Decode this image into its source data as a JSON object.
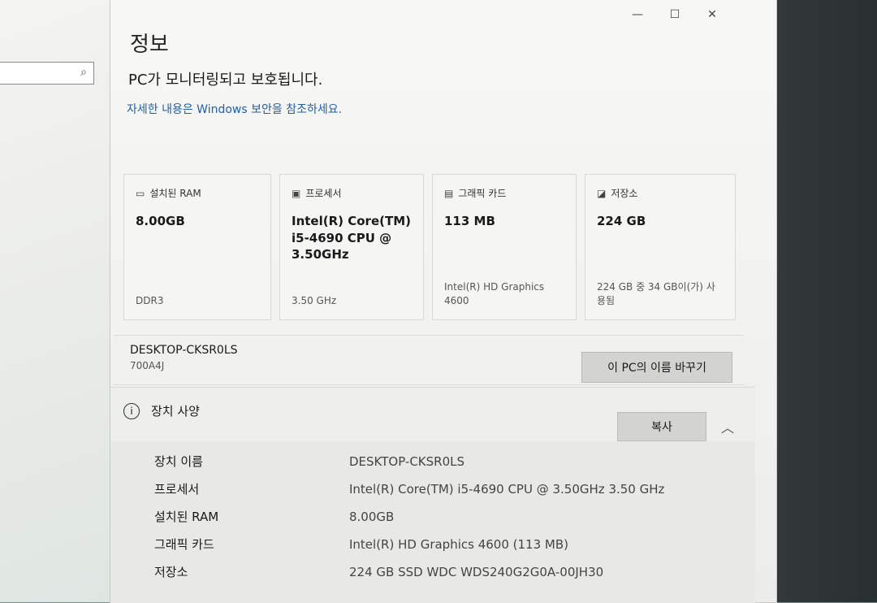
{
  "left_pane": {
    "search_icon": "search-icon"
  },
  "window": {
    "controls": {
      "minimize": "—",
      "maximize": "☐",
      "close": "✕"
    },
    "title": "정보",
    "status": "PC가 모니터링되고 보호됩니다.",
    "security_link": "자세한 내용은 Windows 보안을 참조하세요."
  },
  "cards": [
    {
      "icon": "ram-icon",
      "label": "설치된 RAM",
      "value": "8.00GB",
      "footnote": "DDR3"
    },
    {
      "icon": "processor-icon",
      "label": "프로세서",
      "value": "Intel(R) Core(TM) i5-4690 CPU @ 3.50GHz",
      "footnote": "3.50 GHz"
    },
    {
      "icon": "graphics-card-icon",
      "label": "그래픽 카드",
      "value": "113 MB",
      "footnote": "Intel(R) HD Graphics 4600"
    },
    {
      "icon": "storage-icon",
      "label": "저장소",
      "value": "224 GB",
      "footnote": "224 GB 중 34 GB이(가) 사용됨"
    }
  ],
  "device": {
    "name": "DESKTOP-CKSR0LS",
    "model": "700A4J",
    "rename_button": "이 PC의 이름 바꾸기"
  },
  "specs": {
    "title": "장치 사양",
    "copy_button": "복사",
    "rows": [
      {
        "label": "장치 이름",
        "value": "DESKTOP-CKSR0LS"
      },
      {
        "label": "프로세서",
        "value": "Intel(R) Core(TM) i5-4690 CPU @ 3.50GHz   3.50 GHz"
      },
      {
        "label": "설치된 RAM",
        "value": "8.00GB"
      },
      {
        "label": "그래픽 카드",
        "value": "Intel(R) HD Graphics 4600 (113 MB)"
      },
      {
        "label": "저장소",
        "value": "224 GB SSD WDC WDS240G2G0A-00JH30"
      }
    ]
  }
}
